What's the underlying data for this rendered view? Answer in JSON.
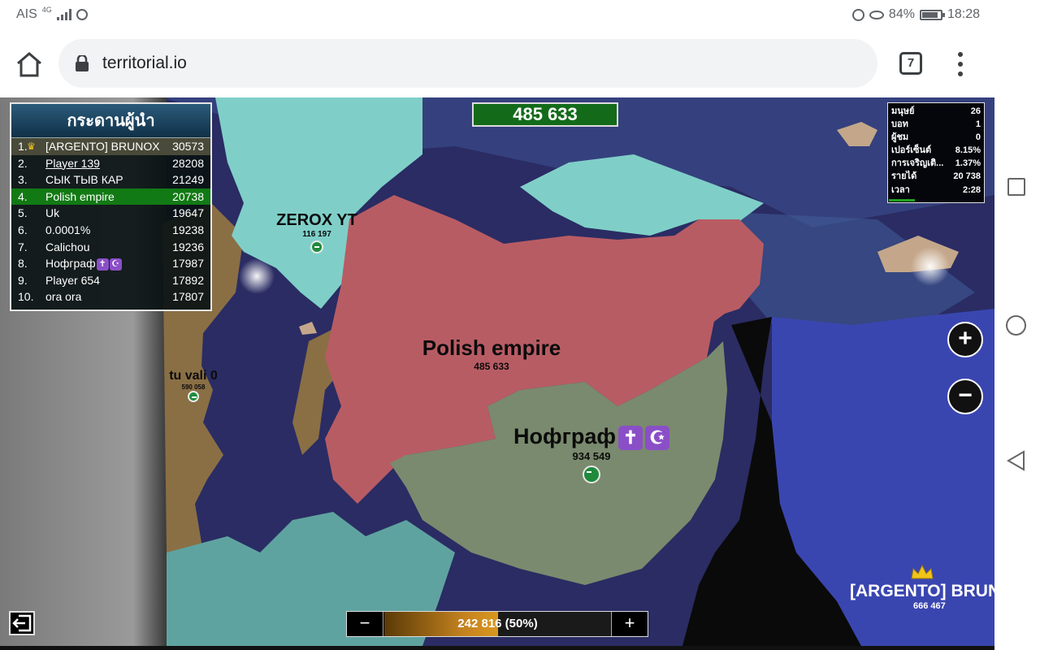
{
  "status_bar": {
    "carrier": "AIS",
    "network": "4G",
    "battery": "84%",
    "battery_level": 0.84,
    "time": "18:28"
  },
  "browser": {
    "url": "territorial.io",
    "tab_count": "7"
  },
  "leaderboard": {
    "title": "กระดานผู้นำ",
    "rows": [
      {
        "rank": "1.",
        "name": "[ARGENTO] BRUNOX",
        "score": "30573",
        "crown": true
      },
      {
        "rank": "2.",
        "name": "Player 139",
        "score": "28208",
        "underline": true
      },
      {
        "rank": "3.",
        "name": "СЫК ТЫВ КАР",
        "score": "21249"
      },
      {
        "rank": "4.",
        "name": "Polish empire",
        "score": "20738",
        "self": true
      },
      {
        "rank": "5.",
        "name": "Uk",
        "score": "19647"
      },
      {
        "rank": "6.",
        "name": "0.0001%",
        "score": "19238"
      },
      {
        "rank": "7.",
        "name": "Calichou",
        "score": "19236"
      },
      {
        "rank": "8.",
        "name": "Нофграф",
        "score": "17987",
        "emojis": [
          "✝",
          "☪"
        ]
      },
      {
        "rank": "9.",
        "name": "Player 654",
        "score": "17892"
      },
      {
        "rank": "10.",
        "name": "ora ora",
        "score": "17807"
      }
    ]
  },
  "top_counter": "485 633",
  "stats": {
    "rows": [
      {
        "label": "มนุษย์",
        "value": "26"
      },
      {
        "label": "บอท",
        "value": "1"
      },
      {
        "label": "ผู้ชม",
        "value": "0"
      },
      {
        "label": "เปอร์เซ็นต์",
        "value": "8.15%"
      },
      {
        "label": "การเจริญเติ...",
        "value": "1.37%"
      },
      {
        "label": "รายได้",
        "value": "20 738"
      },
      {
        "label": "เวลา",
        "value": "2:28"
      }
    ]
  },
  "territories": [
    {
      "name": "ZEROX YT",
      "pop": "116 197",
      "badge": true
    },
    {
      "name": "Polish empire",
      "pop": "485 633",
      "badge": false
    },
    {
      "name": "tu vali 0",
      "pop": "590 058",
      "badge": true
    },
    {
      "name": "Нофграф",
      "pop": "934 549",
      "badge": true,
      "emojis": [
        "✝",
        "☪"
      ]
    },
    {
      "name": "[ARGENTO] BRUN",
      "pop": "666 467",
      "crown": true
    }
  ],
  "attack_bar": {
    "text": "242 816 (50%)",
    "percent": 50,
    "minus": "−",
    "plus": "+"
  },
  "zoom": {
    "in": "+",
    "out": "−"
  },
  "colors": {
    "ocean": "#2a2c63",
    "polish_empire": "#b85c64",
    "zerox": "#7fcfc8",
    "nofgraf": "#7a8a6e",
    "tu_vali": "#8a6f45",
    "argento": "#3a46b0",
    "teal_south": "#5fa3a0",
    "highlight_self": "#127a14"
  }
}
